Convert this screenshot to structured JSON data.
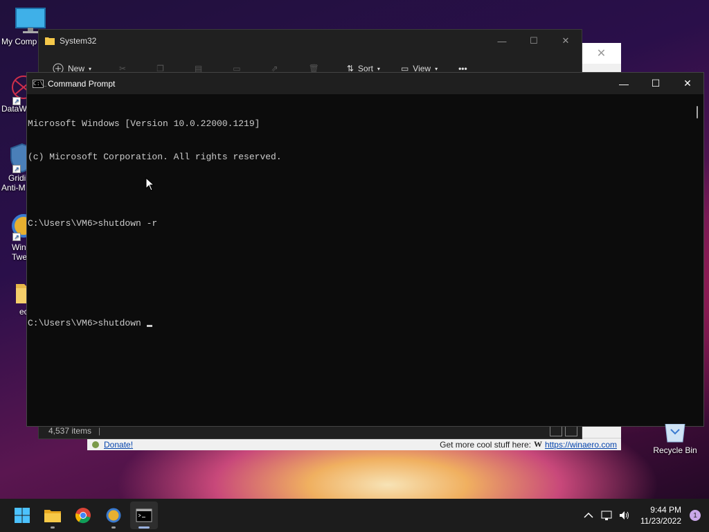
{
  "desktop": {
    "icons": [
      {
        "name": "my-computer",
        "label": "My Comp"
      },
      {
        "name": "datawrapper",
        "label": "DataW"
      },
      {
        "name": "gridinsoft",
        "label": "Gridi",
        "label2": "Anti-M"
      },
      {
        "name": "winaero-tweaker",
        "label": "Win",
        "label2": "Twe"
      },
      {
        "name": "folder",
        "label": "ec"
      }
    ],
    "recycle_bin": "Recycle Bin"
  },
  "explorer": {
    "title": "System32",
    "toolbar": {
      "new": "New",
      "sort": "Sort",
      "view": "View",
      "more": "•••"
    },
    "status": {
      "items": "4,537 items",
      "sep": "|"
    }
  },
  "winaero": {
    "close": "✕",
    "donate": "Donate!",
    "promo": "Get more cool stuff here:",
    "logo_letter": "W",
    "url": "https://winaero.com"
  },
  "cmd": {
    "title": "Command Prompt",
    "icon_text": "C:\\_",
    "lines": [
      "Microsoft Windows [Version 10.0.22000.1219]",
      "(c) Microsoft Corporation. All rights reserved.",
      "",
      "C:\\Users\\VM6>shutdown -r",
      "",
      "",
      "C:\\Users\\VM6>shutdown"
    ],
    "minimize": "—",
    "maximize": "☐",
    "close": "✕"
  },
  "taskbar": {
    "apps": [
      "start",
      "file-explorer",
      "chrome",
      "winaero-tweaker",
      "command-prompt"
    ],
    "time": "9:44 PM",
    "date": "11/23/2022",
    "notifications": "1"
  },
  "colors": {
    "console_bg": "#0c0c0c",
    "console_fg": "#cccccc",
    "taskbar": "#1c1c1c"
  }
}
